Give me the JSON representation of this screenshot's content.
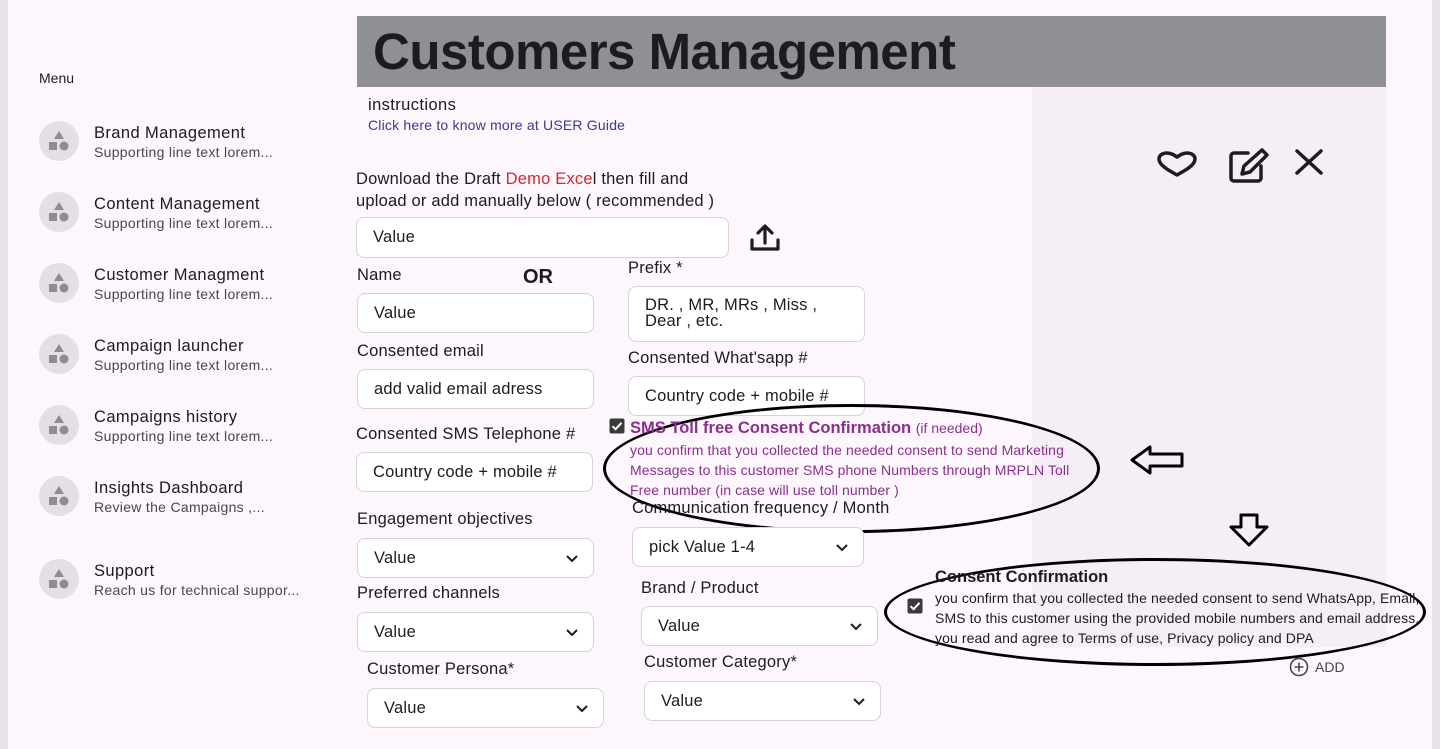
{
  "sidebar": {
    "menu_label": "Menu",
    "items": [
      {
        "title": "Brand Management",
        "subtitle": "Supporting line text lorem..."
      },
      {
        "title": "Content Management",
        "subtitle": "Supporting line text lorem..."
      },
      {
        "title": "Customer Managment",
        "subtitle": "Supporting line text lorem..."
      },
      {
        "title": "Campaign launcher",
        "subtitle": "Supporting line text lorem..."
      },
      {
        "title": "Campaigns history",
        "subtitle": "Supporting line text lorem..."
      },
      {
        "title": "Insights Dashboard",
        "subtitle": "Review the Campaigns ,..."
      },
      {
        "title": "Support",
        "subtitle": "Reach us for technical suppor..."
      }
    ]
  },
  "header": {
    "title": "Customers Management"
  },
  "instructions": {
    "title": "instructions",
    "link": "Click here to know more at USER Guide"
  },
  "download": {
    "pre": "Download the  Draft ",
    "link": "Demo Exce",
    "post": "l then fill and upload or add manually below ( recommended )"
  },
  "upload_field": {
    "value": "Value"
  },
  "or_label": "OR",
  "form": {
    "name": {
      "label": "Name",
      "value": "Value"
    },
    "prefix": {
      "label": "Prefix *",
      "value": "DR. , MR, MRs , Miss , Dear , etc."
    },
    "email": {
      "label": "Consented email",
      "value": "add valid email adress"
    },
    "whatsapp": {
      "label": "Consented What'sapp #",
      "value": "Country code + mobile #"
    },
    "sms": {
      "label": "Consented SMS Telephone #",
      "value": "Country code + mobile #"
    },
    "engagement": {
      "label": "Engagement objectives",
      "value": "Value"
    },
    "frequency": {
      "label": "Communication frequency / Month",
      "value": "pick Value 1-4"
    },
    "channels": {
      "label": "Preferred channels",
      "value": "Value"
    },
    "brand": {
      "label": "Brand / Product",
      "value": "Value"
    },
    "persona": {
      "label": "Customer Persona*",
      "value": "Value"
    },
    "category": {
      "label": "Customer Category*",
      "value": "Value"
    }
  },
  "sms_consent": {
    "title": "SMS Toll free Consent Confirmation",
    "note": "(if needed)",
    "body": "you confirm that you collected the needed consent to send Marketing Messages to this customer SMS phone Numbers through MRPLN Toll Free number (in case will use toll number )"
  },
  "consent": {
    "title": "Consent Confirmation",
    "body": "you confirm that you collected the needed consent to send WhatsApp, Email, SMS to this customer using the provided mobile numbers and email address.  you read and agree to Terms of use, Privacy policy and DPA"
  },
  "add_button": {
    "label": "ADD"
  },
  "icons": {
    "favorite": "heart-icon",
    "edit": "edit-icon",
    "close": "close-icon",
    "upload": "upload-icon",
    "arrow_left": "arrow-left-icon",
    "arrow_down": "arrow-down-icon"
  },
  "colors": {
    "header_bg": "#918f96",
    "consent_text": "#8b2f8f",
    "link_red": "#d12a2a"
  }
}
